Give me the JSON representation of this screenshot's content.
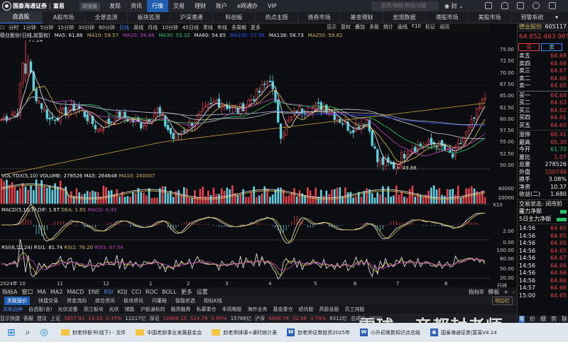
{
  "topbar": {
    "brand": "国泰海通证券",
    "brand2": "富易",
    "version": "超强版",
    "nav": [
      "发现",
      "资讯",
      "行情",
      "交易",
      "理财",
      "账户",
      "e网通办",
      "VIP"
    ],
    "active": 2,
    "search_placeholder": "股票/理财/资讯/功能",
    "user": "封"
  },
  "tabs": [
    "自选股",
    "A股市场",
    "全景监测",
    "板块监测",
    "沪深港通",
    "科创板",
    "热点主题",
    "债券市场",
    "基金理财",
    "宏观数据",
    "港股市场",
    "美股市场",
    "预警系统"
  ],
  "periods": [
    "分时",
    "1分钟",
    "5分钟",
    "15分钟",
    "30分钟",
    "60分钟",
    "日线",
    "周线",
    "月线",
    "10分钟",
    "45日线",
    "季线",
    "年线",
    "多周期",
    "更多"
  ],
  "period_active": 6,
  "tools": [
    "显示",
    "复权",
    "叠加",
    "多股",
    "统计",
    "画线",
    "F10",
    "标记",
    "返回"
  ],
  "main_header": {
    "title": "德业股份(日线,前复权)",
    "ma": [
      {
        "t": "MA5: 61.86",
        "c": "white"
      },
      {
        "t": "MA10: 59.57",
        "c": "yellow"
      },
      {
        "t": "MA20: 56.48",
        "c": "purple"
      },
      {
        "t": "MA30: 55.33",
        "c": "green"
      },
      {
        "t": "MA60: 54.65",
        "c": "white"
      },
      {
        "t": "MA100: 57.96",
        "c": "blue"
      },
      {
        "t": "MA138: 58.73",
        "c": "white"
      },
      {
        "t": "MA250: 59.82",
        "c": "yellow"
      }
    ],
    "high_label": "77.14",
    "low_label": "49.88"
  },
  "price_axis": [
    "75.00",
    "72.50",
    "70.00",
    "67.50",
    "65.00",
    "62.50",
    "60.00",
    "57.50",
    "55.00",
    "52.50",
    "50.00"
  ],
  "price_path": [
    [
      0,
      60
    ],
    [
      6,
      62
    ],
    [
      9,
      77
    ],
    [
      12,
      66
    ],
    [
      18,
      60
    ],
    [
      28,
      63
    ],
    [
      36,
      58
    ],
    [
      44,
      61
    ],
    [
      52,
      59
    ],
    [
      58,
      62
    ],
    [
      64,
      56
    ],
    [
      72,
      60
    ],
    [
      80,
      64
    ],
    [
      88,
      62
    ],
    [
      96,
      66
    ],
    [
      100,
      69
    ],
    [
      104,
      57
    ],
    [
      110,
      62
    ],
    [
      120,
      63
    ],
    [
      130,
      58
    ],
    [
      136,
      60
    ],
    [
      140,
      51
    ],
    [
      146,
      50
    ],
    [
      152,
      54
    ],
    [
      162,
      55
    ],
    [
      168,
      52
    ],
    [
      174,
      58
    ],
    [
      180,
      64.65
    ]
  ],
  "vol": {
    "header": "VOL-TDX(5,10)",
    "volume": "VOLUME: 278526",
    "ma5": "MA5: 264648",
    "ma10": "MA10: 240007",
    "axis": [
      "40000",
      "20000"
    ],
    "unit": "X10"
  },
  "macd": {
    "header": "MACD(5,10,3)",
    "dif": "DIF: 1.87",
    "dea": "DEA: 1.65",
    "macd": "MACD: 0.43",
    "axis": [
      "2.00",
      "0.00"
    ]
  },
  "rsi": {
    "header": "RSI(6,12,24)",
    "rsi1": "RSI1: 81.74",
    "rsi2": "RSI2: 76.20",
    "rsi3": "RSI3: 67.54",
    "axis": [
      "100.00",
      "80.00",
      "50.00",
      "20.00"
    ],
    "period": "日线"
  },
  "dates": [
    "2024年 10",
    "11",
    "12",
    "1",
    "2",
    "3",
    "4",
    "5",
    "6",
    "7",
    "8"
  ],
  "ind_tabs": [
    "指标A",
    "窗口",
    "MA",
    "MA2",
    "MACD",
    "ENE",
    "RSI",
    "KDJ",
    "CCI",
    "ROC",
    "BOLL",
    "更多",
    "设置"
  ],
  "ind_active": 6,
  "ind_right": [
    "指标B",
    "模板",
    "+",
    "-"
  ],
  "side_btn": "侧边栏",
  "rel1": [
    "关联报价",
    "快捷交易",
    "资金流向",
    "综合资讯",
    "板块资讯",
    "问董秘",
    "智能优选",
    "相似K线"
  ],
  "rel2": [
    "关联品种",
    "自选股(含)",
    "光伏设备",
    "浙江板块",
    "光伏",
    "储能",
    "沪股通标的",
    "融资融券",
    "私募重仓",
    "非周期股",
    "海外业务",
    "基金重仓",
    "绩优股",
    "高股息股",
    "员工持股"
  ],
  "quote": {
    "name": "德业股份",
    "code": "605117",
    "price": "64.65",
    "change": "2.46",
    "pct": "3.96%",
    "buy": "买",
    "sell": "卖",
    "asks": [
      [
        "卖五",
        "64.69"
      ],
      [
        "卖四",
        "64.68"
      ],
      [
        "卖三",
        "64.67"
      ],
      [
        "卖二",
        "64.66"
      ],
      [
        "卖一",
        "64.65"
      ]
    ],
    "bids": [
      [
        "买一",
        "64.64"
      ],
      [
        "买二",
        "64.63"
      ],
      [
        "买三",
        "64.62"
      ],
      [
        "买四",
        "64.61"
      ],
      [
        "买五",
        "64.60"
      ]
    ],
    "stats": [
      [
        "涨停",
        "68.41",
        "red"
      ],
      [
        "最高",
        "65.30",
        "red"
      ],
      [
        "今开",
        "61.70",
        "green"
      ],
      [
        "量比",
        "1.07",
        "red"
      ],
      [
        "总量",
        "278526",
        "white"
      ],
      [
        "外盘",
        "150748",
        "red"
      ],
      [
        "换手",
        "3.08%",
        "white"
      ],
      [
        "净资",
        "10.37",
        "white"
      ],
      [
        "收益(二)",
        "1.680",
        "white"
      ]
    ],
    "status": "交易状态: 闭市阶段",
    "main_net": "主力净额",
    "net5": "5日主力净额",
    "ticks": [
      [
        "14:56",
        "64.65"
      ],
      [
        "14:56",
        "64.65"
      ],
      [
        "14:56",
        "64.65"
      ],
      [
        "14:56",
        "64.65"
      ],
      [
        "14:56",
        "64.67"
      ],
      [
        "14:56",
        "64.66"
      ],
      [
        "14:56",
        "64.66"
      ],
      [
        "14:56",
        "64.66"
      ],
      [
        "14:57",
        "64.66"
      ],
      [
        "15:00",
        "64.65"
      ]
    ],
    "tabs": [
      "笔",
      "价",
      "细",
      "势",
      "联"
    ]
  },
  "statusbar": {
    "items": [
      "显示快捷",
      "客服",
      "建议"
    ],
    "indices": [
      {
        "n": "上证",
        "v": "3857.93",
        "c": "14.33",
        "p": "0.37%",
        "a": "12217亿"
      },
      {
        "n": "深证",
        "v": "12696.15",
        "c": "124.78",
        "p": "0.99%",
        "a": "15766亿"
      },
      {
        "n": "沪深",
        "v": "4496.76",
        "c": "32.98",
        "p": "0.74%",
        "a": "8312亿"
      }
    ],
    "total_label": "总成交",
    "total": "2830"
  },
  "watermark": "雪球 · 帝都封老师",
  "taskbar": [
    "封老师板书(线下) - 文件",
    "中国老龄事业发展基金会",
    "封老师排课+课时统计表",
    "封老师证券投资2025年",
    "小升初奥数知识点总结",
    "国泰海通证券|富易V4.14"
  ]
}
